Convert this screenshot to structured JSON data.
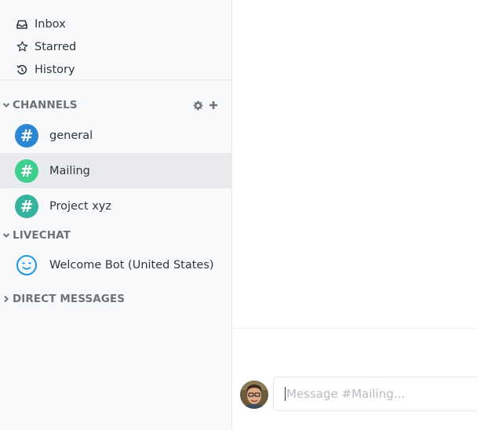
{
  "nav": [
    {
      "label": "Inbox",
      "icon": "inbox-icon"
    },
    {
      "label": "Starred",
      "icon": "star-icon"
    },
    {
      "label": "History",
      "icon": "history-icon"
    }
  ],
  "channels_section": {
    "title": "CHANNELS",
    "settings_icon": "gear-icon",
    "add_icon": "plus-icon"
  },
  "channels": [
    {
      "name": "general",
      "color": "#2b87d1"
    },
    {
      "name": "Mailing",
      "color": "#3ecf8e",
      "active": true
    },
    {
      "name": "Project xyz",
      "color": "#36b39f"
    }
  ],
  "livechat_section": {
    "title": "LIVECHAT"
  },
  "livechat": [
    {
      "name": "Welcome Bot (United States)",
      "icon": "smiley-icon",
      "color": "#1d96e5"
    }
  ],
  "direct_section": {
    "title": "DIRECT MESSAGES"
  },
  "composer": {
    "placeholder": "Message #Mailing..."
  },
  "colors": {
    "sidebar_bg": "#f8f9fa",
    "active_row": "#e8eaed",
    "text": "#2f343d",
    "muted": "#6c727a"
  }
}
